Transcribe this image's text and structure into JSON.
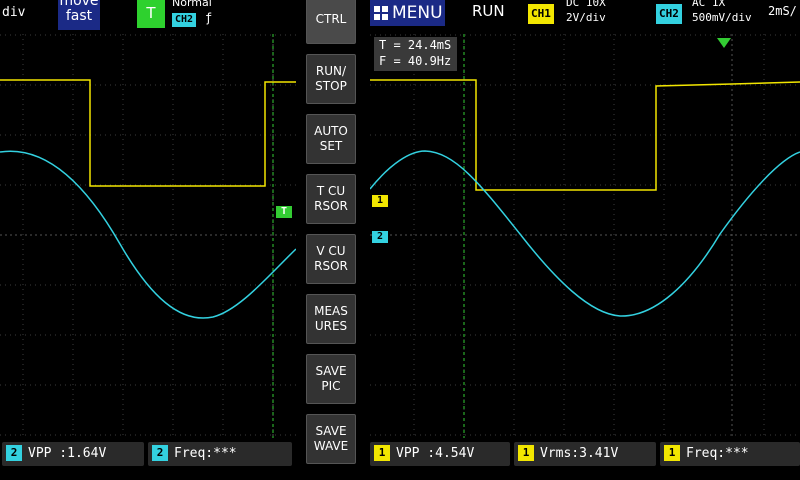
{
  "left_top": {
    "timebase_fragment": "div",
    "move_line1": "move",
    "move_line2": "fast",
    "trigger_letter": "T",
    "trigger_mode": "Normal",
    "trigger_channel": "CH2",
    "trigger_edge_glyph": "ƒ"
  },
  "right_top": {
    "menu_label": "MENU",
    "run_state": "RUN",
    "ch1": {
      "tag": "CH1",
      "coupling": "DC  10X",
      "scale": "2V/div"
    },
    "ch2": {
      "tag": "CH2",
      "coupling": "AC  1X",
      "scale": "500mV/div"
    },
    "timebase": "2mS/"
  },
  "buttons": [
    {
      "label": "CTRL"
    },
    {
      "label": "RUN/\nSTOP"
    },
    {
      "label": "AUTO\nSET"
    },
    {
      "label": "T CU\nRSOR"
    },
    {
      "label": "V CU\nRSOR"
    },
    {
      "label": "MEAS\nURES"
    },
    {
      "label": "SAVE\nPIC"
    },
    {
      "label": "SAVE\nWAVE"
    }
  ],
  "cursor_readout": {
    "period": "T = 24.4mS",
    "freq": "F = 40.9Hz"
  },
  "markers": {
    "trigger": "T",
    "ch1": "1",
    "ch2": "2"
  },
  "measurements_left": [
    {
      "channel": "2",
      "text": "VPP :1.64V"
    },
    {
      "channel": "2",
      "text": "Freq:***"
    }
  ],
  "measurements_right": [
    {
      "channel": "1",
      "text": "VPP :4.54V"
    },
    {
      "channel": "1",
      "text": "Vrms:3.41V"
    },
    {
      "channel": "1",
      "text": "Freq:***"
    }
  ],
  "colors": {
    "ch1": "#f2e600",
    "ch2": "#33d1e0",
    "grid": "#3c3c3c",
    "cursor": "#33cc33",
    "menu": "#1b2a86"
  }
}
